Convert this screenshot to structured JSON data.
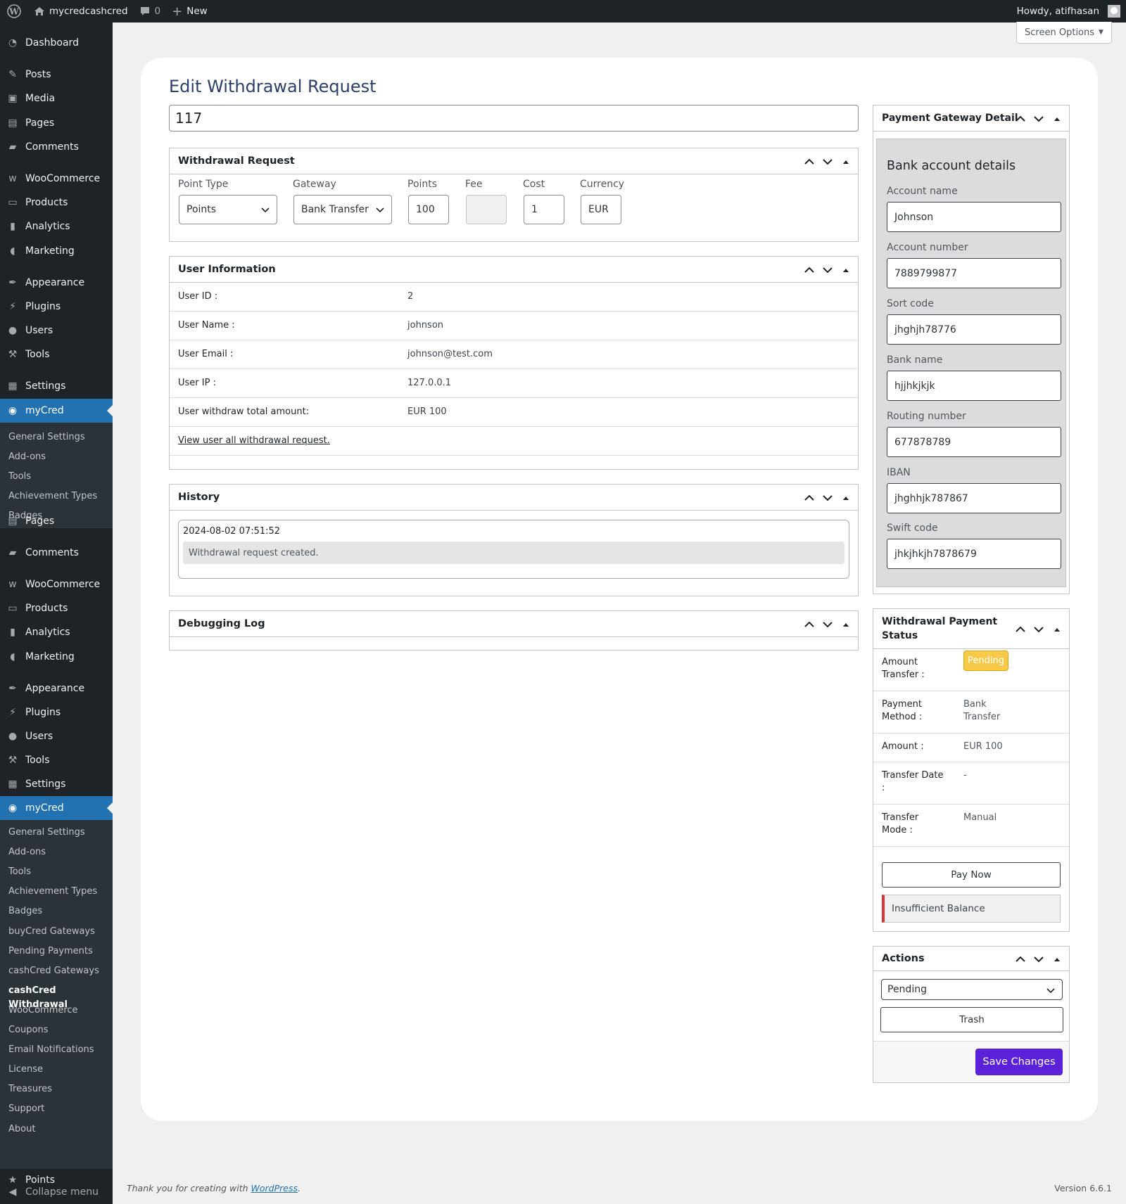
{
  "adminbar": {
    "site_name": "mycredcashcred",
    "comments_count": "0",
    "new_label": "New",
    "howdy": "Howdy, atifhasan"
  },
  "sidebar": {
    "group1": [
      {
        "label": "Dashboard",
        "icon": "dashboard-icon"
      },
      {
        "label": "Posts",
        "icon": "pin-icon"
      },
      {
        "label": "Media",
        "icon": "media-icon"
      },
      {
        "label": "Pages",
        "icon": "page-icon"
      },
      {
        "label": "Comments",
        "icon": "comment-icon"
      },
      {
        "label": "WooCommerce",
        "icon": "woo-icon"
      },
      {
        "label": "Products",
        "icon": "archive-icon"
      },
      {
        "label": "Analytics",
        "icon": "bar-chart-icon"
      },
      {
        "label": "Marketing",
        "icon": "megaphone-icon"
      },
      {
        "label": "Appearance",
        "icon": "brush-icon"
      },
      {
        "label": "Plugins",
        "icon": "plug-icon"
      },
      {
        "label": "Users",
        "icon": "user-icon"
      },
      {
        "label": "Tools",
        "icon": "wrench-icon"
      },
      {
        "label": "Settings",
        "icon": "settings-icon"
      },
      {
        "label": "myCred",
        "icon": "mycred-icon"
      }
    ],
    "submenu1": [
      "General Settings",
      "Add-ons",
      "Tools",
      "Achievement Types",
      "Badges"
    ],
    "group2": [
      {
        "label": "Pages",
        "icon": "page-icon"
      },
      {
        "label": "Comments",
        "icon": "comment-icon"
      },
      {
        "label": "WooCommerce",
        "icon": "woo-icon"
      },
      {
        "label": "Products",
        "icon": "archive-icon"
      },
      {
        "label": "Analytics",
        "icon": "bar-chart-icon"
      },
      {
        "label": "Marketing",
        "icon": "megaphone-icon"
      },
      {
        "label": "Appearance",
        "icon": "brush-icon"
      },
      {
        "label": "Plugins",
        "icon": "plug-icon"
      },
      {
        "label": "Users",
        "icon": "user-icon"
      },
      {
        "label": "Tools",
        "icon": "wrench-icon"
      },
      {
        "label": "Settings",
        "icon": "settings-icon"
      },
      {
        "label": "myCred",
        "icon": "mycred-icon"
      }
    ],
    "submenu2": [
      "General Settings",
      "Add-ons",
      "Tools",
      "Achievement Types",
      "Badges",
      "buyCred Gateways",
      "Pending Payments",
      "cashCred Gateways",
      "cashCred Withdrawal",
      "WooCommerce",
      "Coupons",
      "Email Notifications",
      "License",
      "Treasures",
      "Support",
      "About"
    ],
    "active_submenu": "cashCred Withdrawal",
    "points": "Points",
    "collapse": "Collapse menu"
  },
  "screen_options": "Screen Options",
  "page_title": "Edit Withdrawal Request",
  "title_value": "117",
  "withdrawal_request": {
    "heading": "Withdrawal Request",
    "fields": {
      "point_type_label": "Point Type",
      "point_type": "Points",
      "gateway_label": "Gateway",
      "gateway": "Bank Transfer",
      "points_label": "Points",
      "points": "100",
      "fee_label": "Fee",
      "fee": "",
      "cost_label": "Cost",
      "cost": "1",
      "currency_label": "Currency",
      "currency": "EUR"
    }
  },
  "user_info": {
    "heading": "User Information",
    "rows": [
      {
        "label": "User ID :",
        "value": "2"
      },
      {
        "label": "User Name :",
        "value": "johnson"
      },
      {
        "label": "User Email :",
        "value": "johnson@test.com"
      },
      {
        "label": "User IP :",
        "value": "127.0.0.1"
      },
      {
        "label": "User withdraw total amount:",
        "value": "EUR 100"
      }
    ],
    "link": "View user all withdrawal request."
  },
  "history": {
    "heading": "History",
    "date": "2024-08-02 07:51:52",
    "message": "Withdrawal request created."
  },
  "debug": {
    "heading": "Debugging Log"
  },
  "gateway_detail": {
    "heading": "Payment Gateway Detail",
    "title": "Bank account details",
    "fields": [
      {
        "label": "Account name",
        "value": "Johnson"
      },
      {
        "label": "Account number",
        "value": "7889799877"
      },
      {
        "label": "Sort code",
        "value": "jhghjh78776"
      },
      {
        "label": "Bank name",
        "value": "hjjhkjkjk"
      },
      {
        "label": "Routing number",
        "value": "677878789"
      },
      {
        "label": "IBAN",
        "value": "jhghhjk787867"
      },
      {
        "label": "Swift code",
        "value": "jhkjhkjh7878679"
      }
    ]
  },
  "payment_status": {
    "heading_line1": "Withdrawal Payment",
    "heading_line2": "Status",
    "amount_transfer_label1": "Amount",
    "amount_transfer_label2": "Transfer :",
    "amount_transfer_value": "Pending",
    "method_label1": "Payment",
    "method_label2": "Method :",
    "method_value1": "Bank",
    "method_value2": "Transfer",
    "amount_label": "Amount :",
    "amount_value": "EUR 100",
    "date_label1": "Transfer Date",
    "date_label2": ":",
    "date_value": "-",
    "mode_label1": "Transfer",
    "mode_label2": "Mode :",
    "mode_value": "Manual",
    "pay_now": "Pay Now",
    "notice": "Insufficient Balance"
  },
  "actions": {
    "heading": "Actions",
    "status_selected": "Pending",
    "trash": "Trash",
    "save": "Save Changes"
  },
  "footer": {
    "thanks": "Thank you for creating with ",
    "wp_link": "WordPress",
    "period": ".",
    "version": "Version 6.6.1"
  },
  "colors": {
    "accent": "#2271b1",
    "primary_button": "#5b21d9",
    "pending_badge": "#f7c948",
    "sidebar_bg": "#1d2327"
  }
}
